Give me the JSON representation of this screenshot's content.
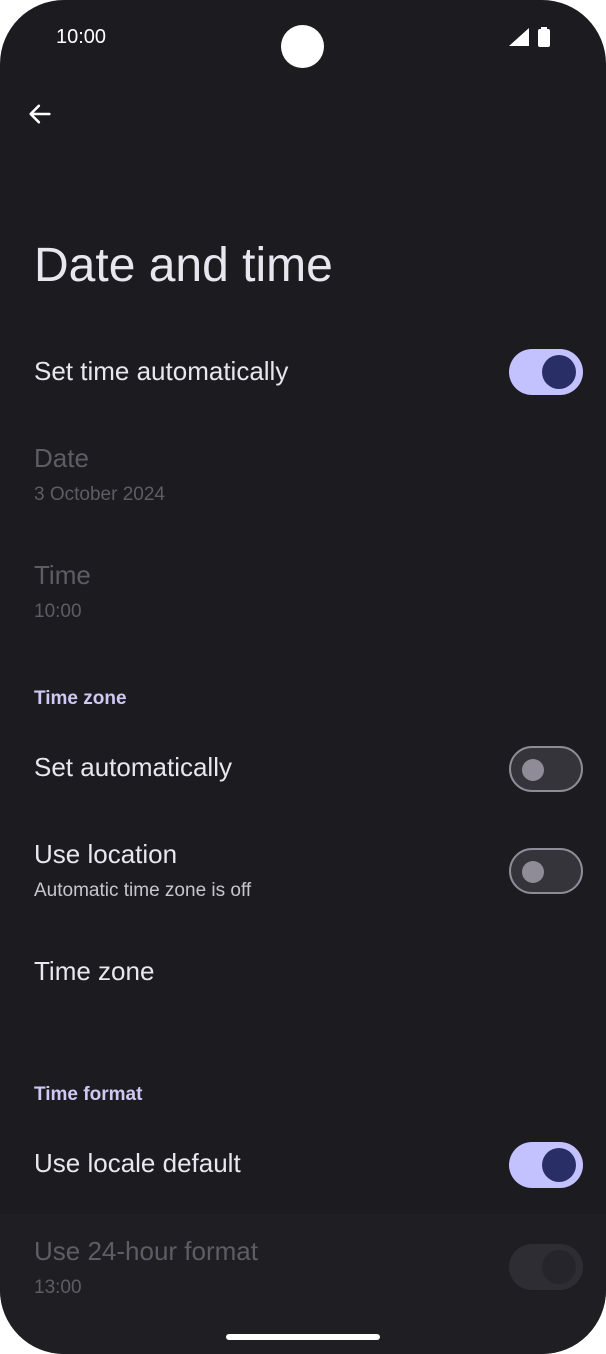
{
  "status_bar": {
    "time": "10:00",
    "icons": [
      "camera-cutout",
      "cell-signal-icon",
      "battery-icon"
    ]
  },
  "header": {
    "back_icon": "back-arrow-icon",
    "title": "Date and time"
  },
  "items": {
    "set_time_automatically": {
      "title": "Set time automatically",
      "toggle": "on"
    },
    "date": {
      "title": "Date",
      "value": "3 October 2024"
    },
    "time": {
      "title": "Time",
      "value": "10:00"
    },
    "time_zone_section": {
      "label": "Time zone"
    },
    "set_automatically": {
      "title": "Set automatically",
      "toggle": "off"
    },
    "use_location": {
      "title": "Use location",
      "subtitle": "Automatic time zone is off",
      "toggle": "off"
    },
    "time_zone": {
      "title": "Time zone"
    },
    "time_format_section": {
      "label": "Time format"
    },
    "use_locale_default": {
      "title": "Use locale default",
      "toggle": "on"
    },
    "use_24_hour": {
      "title": "Use 24-hour format",
      "subtitle": "13:00",
      "toggle": "disabled"
    }
  },
  "colors": {
    "background": "#1c1b20",
    "accent": "#c3c2ff",
    "section_label": "#cfc8f5"
  }
}
